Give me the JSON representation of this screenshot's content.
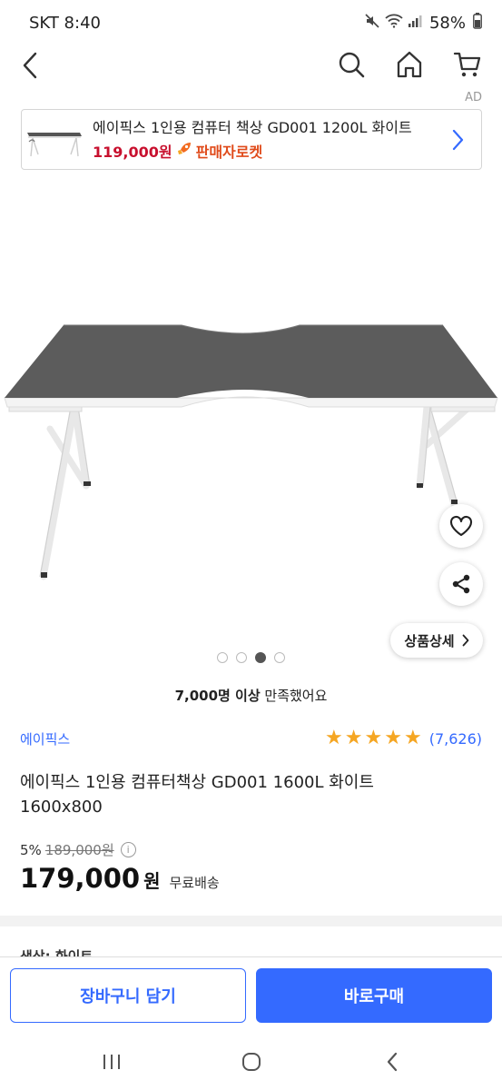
{
  "status_bar": {
    "carrier_time": "SKT 8:40",
    "battery": "58%"
  },
  "ad": {
    "label": "AD",
    "title": "에이픽스 1인용 컴퓨터 책상 GD001 1200L 화이트",
    "price": "119,000원",
    "badge": "판매자로켓"
  },
  "gallery": {
    "dot_count": 4,
    "active_dot": 3
  },
  "detail_button_label": "상품상세",
  "satisfaction": {
    "bold": "7,000명 이상",
    "rest": " 만족했어요"
  },
  "product": {
    "brand": "에이픽스",
    "rating": 5,
    "review_count": "(7,626)",
    "title_line1": "에이픽스 1인용 컴퓨터책상 GD001 1600L 화이트",
    "title_line2": "1600x800",
    "discount": "5%",
    "original_price": "189,000원",
    "price": "179,000",
    "price_unit": "원",
    "shipping": "무료배송"
  },
  "option_peek": "색상: 화이트",
  "bottom": {
    "cart_label": "장바구니 담기",
    "buy_label": "바로구매"
  },
  "colors": {
    "accent": "#346aff",
    "price_red": "#c8102e",
    "star": "#f5a623"
  }
}
